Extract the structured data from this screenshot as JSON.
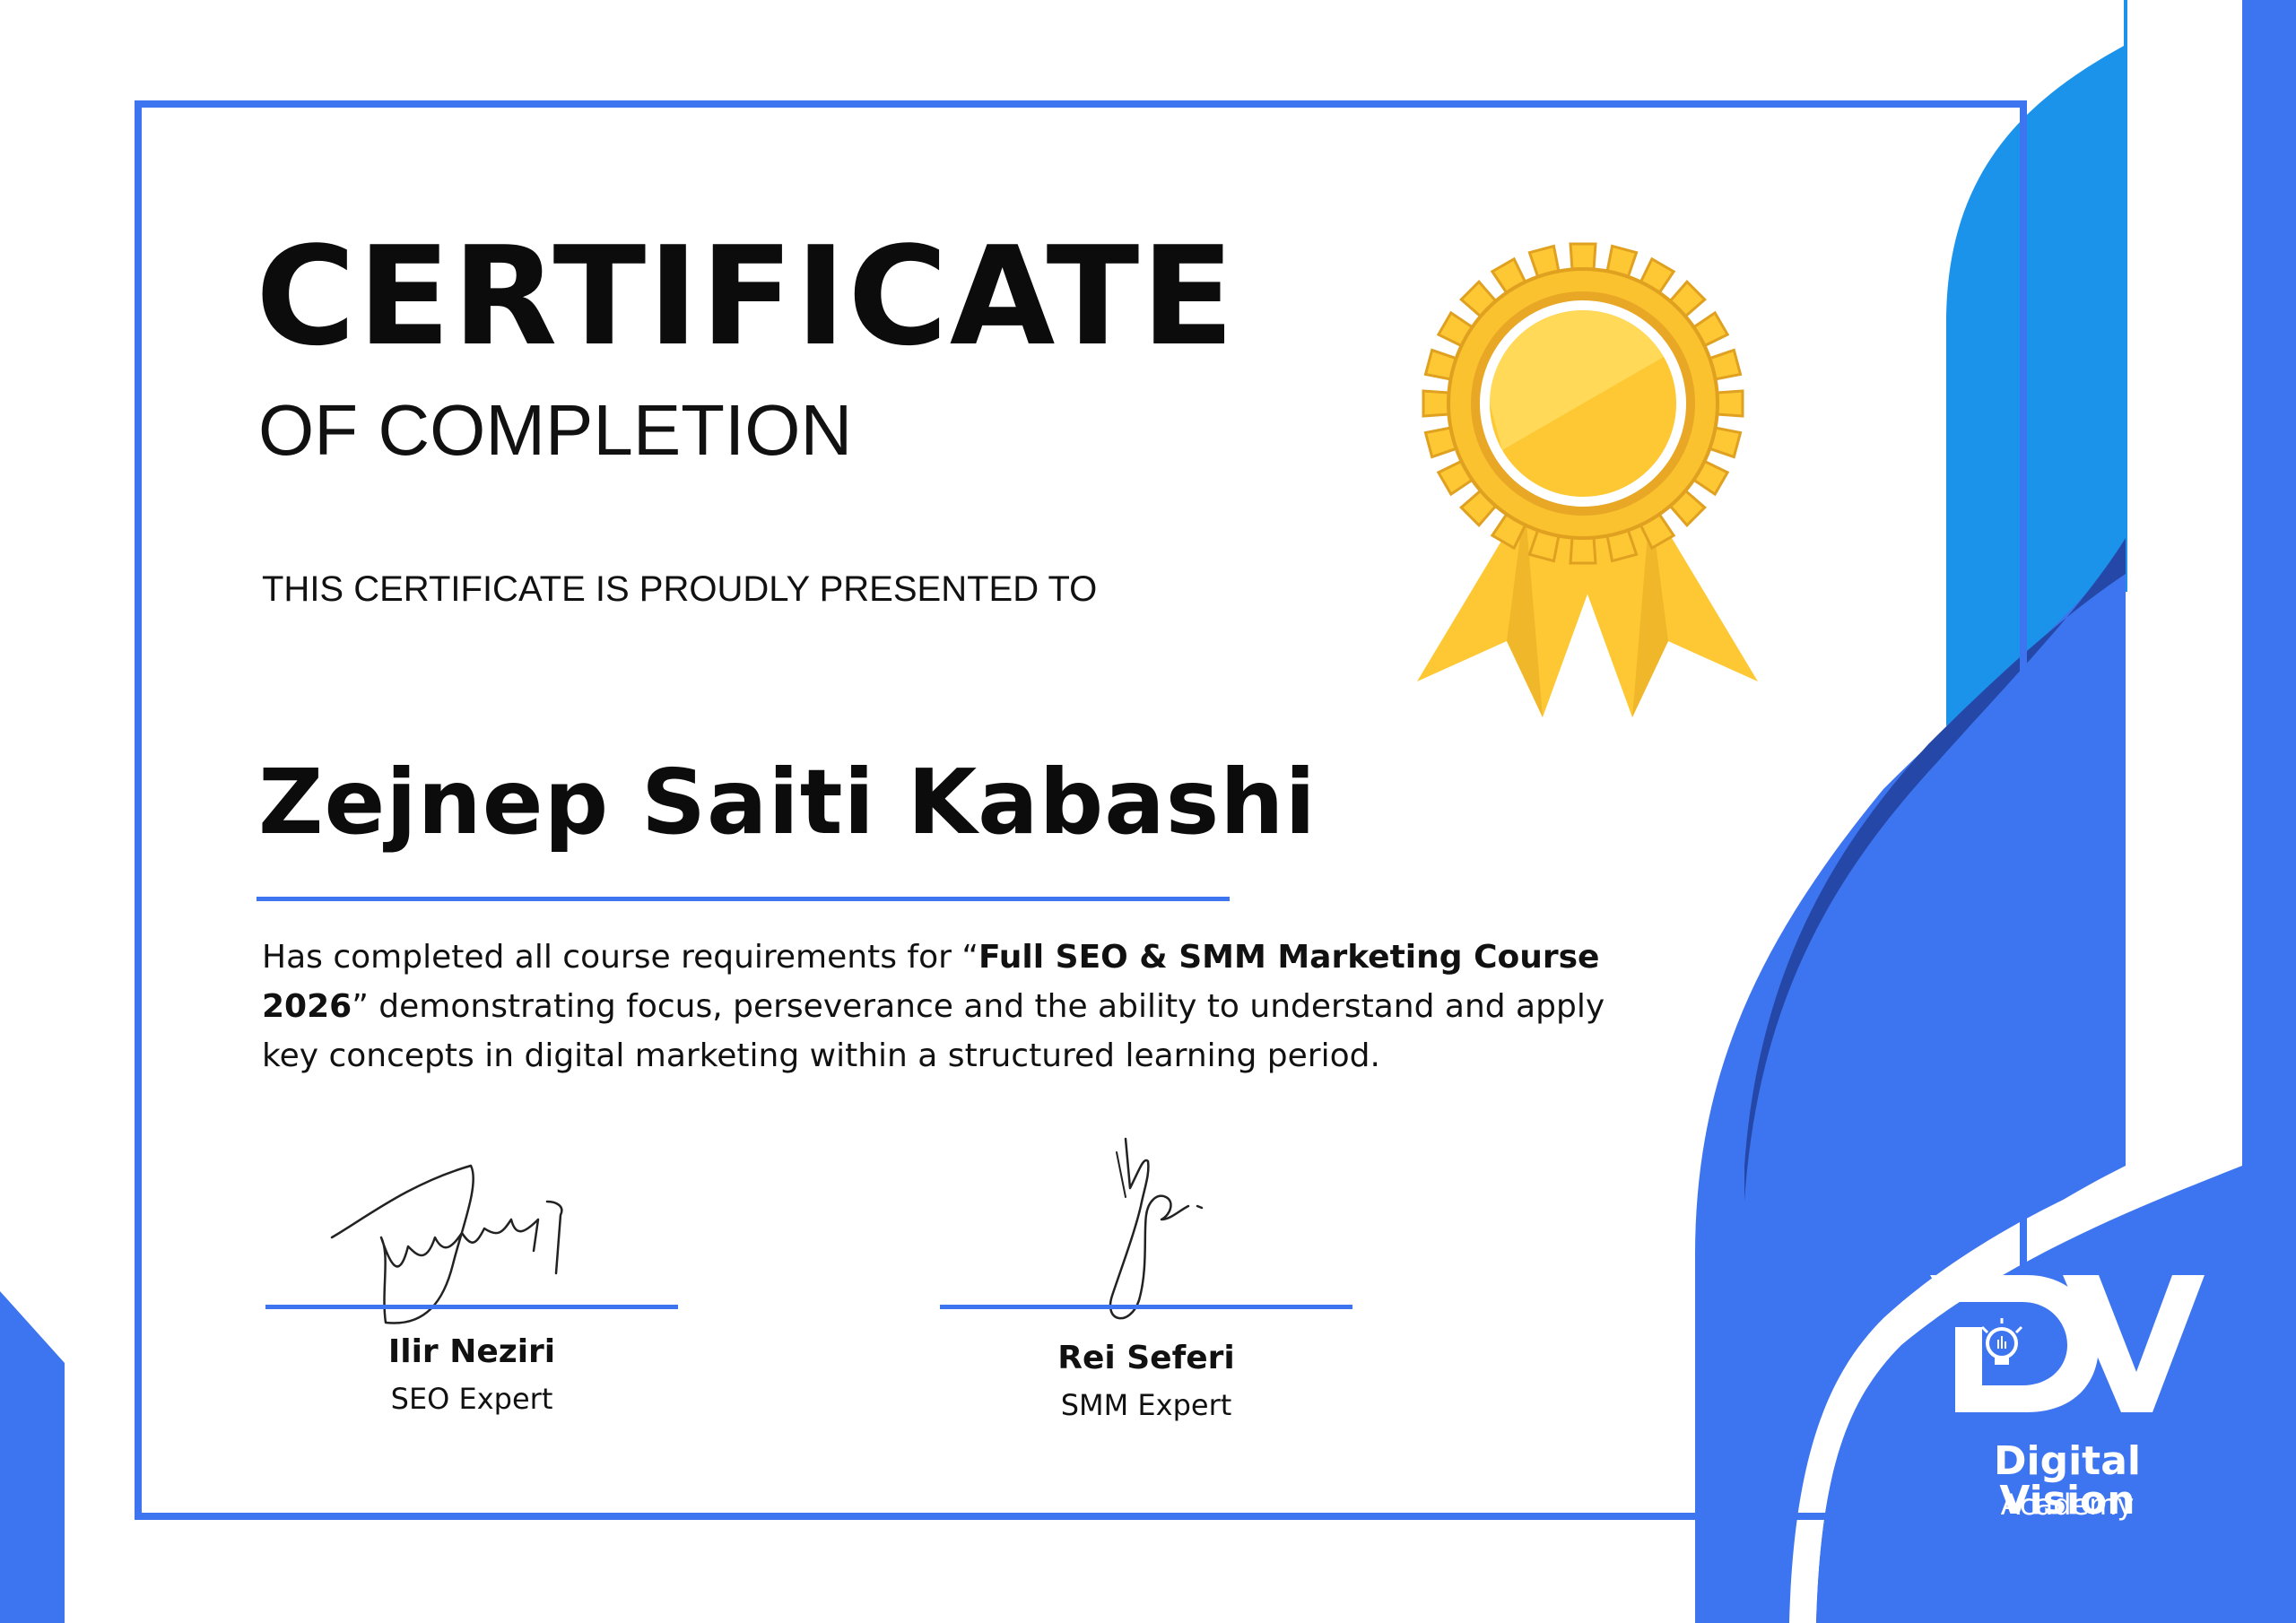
{
  "certificate": {
    "title": "CERTIFICATE",
    "subtitle": "OF COMPLETION",
    "presented_to": "THIS CERTIFICATE IS PROUDLY PRESENTED TO",
    "recipient_name": "Zejnep Saiti Kabashi",
    "description": {
      "part1": "Has completed all course requirements for “",
      "course_name": "Full SEO & SMM Marketing Course 2026",
      "part2": "” demonstrating focus, perseverance and the ability to understand and apply key concepts in digital marketing within a structured learning period."
    }
  },
  "signatories": [
    {
      "name": "Ilir Neziri",
      "role": "SEO Expert"
    },
    {
      "name": "Rei Seferi",
      "role": "SMM Expert"
    }
  ],
  "branding": {
    "logo_letters": "DV",
    "name": "Digital Vision",
    "tagline": "Academy"
  },
  "icons": {
    "award": "award-ribbon-icon",
    "logo": "dv-logo-icon",
    "bulb": "lightbulb-icon"
  },
  "colors": {
    "primary_blue": "#3d74ef",
    "light_blue": "#1b93ea",
    "dark_blue": "#2548a8",
    "gold": "#fdc834",
    "gold_dark": "#e0a020",
    "text": "#111111"
  }
}
